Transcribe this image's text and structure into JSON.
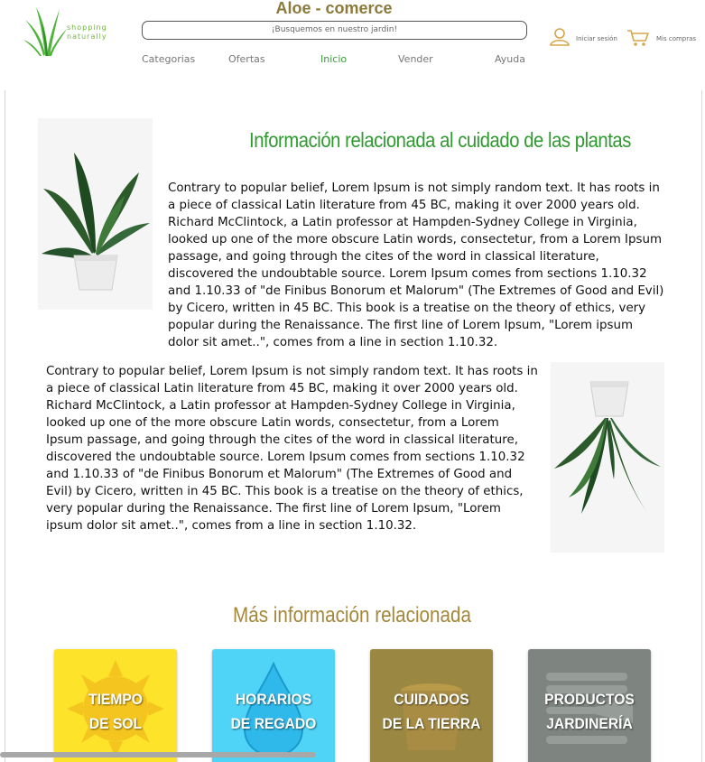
{
  "header": {
    "brand": "Aloe - comerce",
    "logo_tagline_1": "shopping",
    "logo_tagline_2": "naturally",
    "search_placeholder": "¡Busquemos en nuestro jardin!",
    "nav": [
      "Categorias",
      "Ofertas",
      "Inicio",
      "Vender",
      "Ayuda"
    ],
    "active_nav": "Inicio",
    "login_label": "Iniciar sesión",
    "cart_label": "Mis compras",
    "icons": {
      "logo": "aloe-plant-logo",
      "login": "user-icon",
      "cart": "cart-icon"
    }
  },
  "article": {
    "title": "Información relacionada al cuidado de las plantas",
    "paragraph_1": "Contrary to popular belief, Lorem Ipsum is not simply random text. It has roots in a piece of classical Latin literature from 45 BC, making it over 2000 years old. Richard McClintock, a Latin professor at Hampden-Sydney College in Virginia, looked up one of the more obscure Latin words, consectetur, from a Lorem Ipsum passage, and going through the cites of the word in classical literature, discovered the undoubtable source. Lorem Ipsum comes from sections 1.10.32 and 1.10.33 of \"de Finibus Bonorum et Malorum\" (The Extremes of Good and Evil) by Cicero, written in 45 BC. This book is a treatise on the theory of ethics, very popular during the Renaissance. The first line of Lorem Ipsum, \"Lorem ipsum dolor sit amet..\", comes from a line in section 1.10.32.",
    "paragraph_2": "Contrary to popular belief, Lorem Ipsum is not simply random text. It has roots in a piece of classical Latin literature from 45 BC, making it over 2000 years old. Richard McClintock, a Latin professor at Hampden-Sydney College in Virginia, looked up one of the more obscure Latin words, consectetur, from a Lorem Ipsum passage, and going through the cites of the word in classical literature, discovered the undoubtable source. Lorem Ipsum comes from sections 1.10.32 and 1.10.33 of \"de Finibus Bonorum et Malorum\" (The Extremes of Good and Evil) by Cicero, written in 45 BC. This book is a treatise on the theory of ethics, very popular during the Renaissance. The first line of Lorem Ipsum, \"Lorem ipsum dolor sit amet..\", comes from a line in section 1.10.32."
  },
  "related": {
    "title": "Más información relacionada",
    "cards": [
      {
        "line1": "TIEMPO",
        "line2": "DE SOL",
        "color": "#fde32a",
        "icon": "sun-icon"
      },
      {
        "line1": "HORARIOS",
        "line2": "DE REGADO",
        "color": "#4fd4f7",
        "icon": "water-drop-icon"
      },
      {
        "line1": "CUIDADOS",
        "line2": "DE LA TIERRA",
        "color": "#9a8741",
        "icon": "flower-pot-icon"
      },
      {
        "line1": "PRODUCTOS",
        "line2": "JARDINERÍA",
        "color": "#7e8480",
        "icon": "garden-tools-icon"
      }
    ]
  },
  "colors": {
    "accent_green": "#2f9a2f",
    "accent_gold": "#a5873a",
    "brand_text": "#8b7a3a"
  }
}
